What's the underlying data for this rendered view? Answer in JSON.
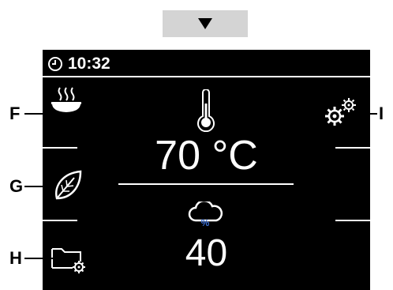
{
  "nav": {
    "down_icon": "triangle-down-icon"
  },
  "status_bar": {
    "clock_icon": "clock-icon",
    "time": "10:32"
  },
  "left_menu": [
    {
      "id": "F",
      "icon": "heating-bowl-icon"
    },
    {
      "id": "G",
      "icon": "leaf-icon"
    },
    {
      "id": "H",
      "icon": "folder-settings-icon"
    }
  ],
  "right_menu": [
    {
      "id": "I",
      "icon": "gears-icon"
    }
  ],
  "center": {
    "thermometer_icon": "thermometer-icon",
    "temperature": "70 °C",
    "humidity_icon": "cloud-humidity-icon",
    "humidity_percent_symbol": "%",
    "humidity_value": "40"
  },
  "callouts": {
    "F": "F",
    "G": "G",
    "H": "H",
    "I": "I"
  },
  "colors": {
    "screen_bg": "#000000",
    "screen_fg": "#ffffff",
    "button_bg": "#d4d4d4",
    "humidity_accent": "#3b6fd6"
  }
}
